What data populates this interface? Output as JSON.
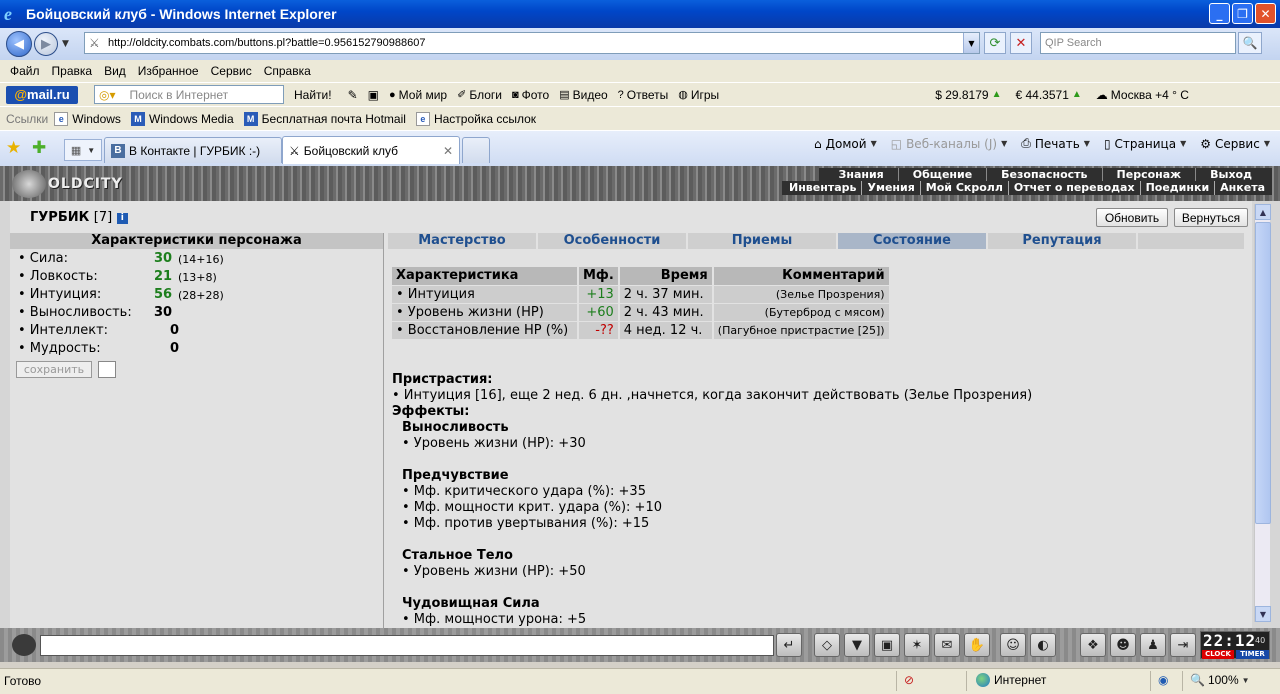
{
  "window": {
    "title": "Бойцовский клуб - Windows Internet Explorer"
  },
  "address": {
    "url": "http://oldcity.combats.com/buttons.pl?battle=0.956152790988607",
    "search_placeholder": "QIP Search"
  },
  "menu": [
    "Файл",
    "Правка",
    "Вид",
    "Избранное",
    "Сервис",
    "Справка"
  ],
  "mailbar": {
    "logo_at": "@",
    "logo_text": "mail.ru",
    "search_placeholder": "Поиск в Интернет",
    "find": "Найти!",
    "items": [
      "Мой мир",
      "Блоги",
      "Фото",
      "Видео",
      "Ответы",
      "Игры"
    ],
    "usd": "$ 29.8179",
    "eur": "€ 44.3571",
    "weather": "Москва +4 ° C"
  },
  "links": {
    "label": "Ссылки",
    "items": [
      "Windows",
      "Windows Media",
      "Бесплатная почта Hotmail",
      "Настройка ссылок"
    ]
  },
  "tabs": [
    {
      "label": "В Контакте | ГУРБИК :-)",
      "icon": "В"
    },
    {
      "label": "Бойцовский клуб"
    }
  ],
  "commandbar": {
    "home": "Домой",
    "feeds": "Веб-каналы (J)",
    "print": "Печать",
    "page": "Страница",
    "tools": "Сервис"
  },
  "game": {
    "logo": "OLDCITY",
    "topnav": [
      "Знания",
      "Общение",
      "Безопасность",
      "Персонаж",
      "Выход"
    ],
    "subnav": [
      "Инвентарь",
      "Умения",
      "Мой Скролл",
      "Отчет о переводах",
      "Поединки",
      "Анкета"
    ],
    "char_name": "ГУРБИК",
    "char_level": "[7]",
    "info_icon": "i",
    "refresh_btn": "Обновить",
    "back_btn": "Вернуться",
    "panel_title": "Характеристики персонажа",
    "stats": [
      {
        "name": "• Сила:",
        "value": "30",
        "sub": "(14+16)",
        "green": true
      },
      {
        "name": "• Ловкость:",
        "value": "21",
        "sub": "(13+8)",
        "green": true
      },
      {
        "name": "• Интуиция:",
        "value": "56",
        "sub": "(28+28)",
        "green": true
      },
      {
        "name": "• Выносливость:",
        "value": "30",
        "sub": "",
        "green": false
      },
      {
        "name": "• Интеллект:",
        "value": "0",
        "sub": "",
        "green": false
      },
      {
        "name": "• Мудрость:",
        "value": "0",
        "sub": "",
        "green": false
      }
    ],
    "save_btn": "сохранить",
    "tabs": [
      "Мастерство",
      "Особенности",
      "Приемы",
      "Состояние",
      "Репутация"
    ],
    "table": {
      "headers": [
        "Характеристика",
        "Мф.",
        "Время",
        "Комментарий"
      ],
      "rows": [
        [
          "• Интуиция",
          "+13",
          "2 ч. 37 мин.",
          "(Зелье Прозрения)"
        ],
        [
          "• Уровень жизни (HP)",
          "+60",
          "2 ч. 43 мин.",
          "(Бутерброд с мясом)"
        ],
        [
          "• Восстановление HP (%)",
          "-??",
          "4 нед. 12 ч.",
          "(Пагубное пристрастие [25])"
        ]
      ]
    },
    "addictions_title": "Пристрастия:",
    "addiction_line": "• Интуиция [16], еще 2 нед. 6 дн. ,начнется, когда закончит действовать (Зелье Прозрения)",
    "effects_title": "Эффекты:",
    "effects": [
      {
        "name": "Выносливость",
        "lines": [
          "• Уровень жизни (HP): +30"
        ]
      },
      {
        "name": "Предчувствие",
        "lines": [
          "• Мф. критического удара (%): +35",
          "• Мф. мощности крит. удара (%): +10",
          "• Мф. против увертывания (%): +15"
        ]
      },
      {
        "name": "Стальное Тело",
        "lines": [
          "• Уровень жизни (HP): +50"
        ]
      },
      {
        "name": "Чудовищная Сила",
        "lines": [
          "• Мф. мощности урона: +5"
        ]
      }
    ]
  },
  "chat": {
    "clock_time": "22:12",
    "clock_sec": "40",
    "clock_label": "CLOCK",
    "timer_label": "TIMER"
  },
  "status": {
    "text": "Готово",
    "zone": "Интернет",
    "zoom": "100%"
  }
}
